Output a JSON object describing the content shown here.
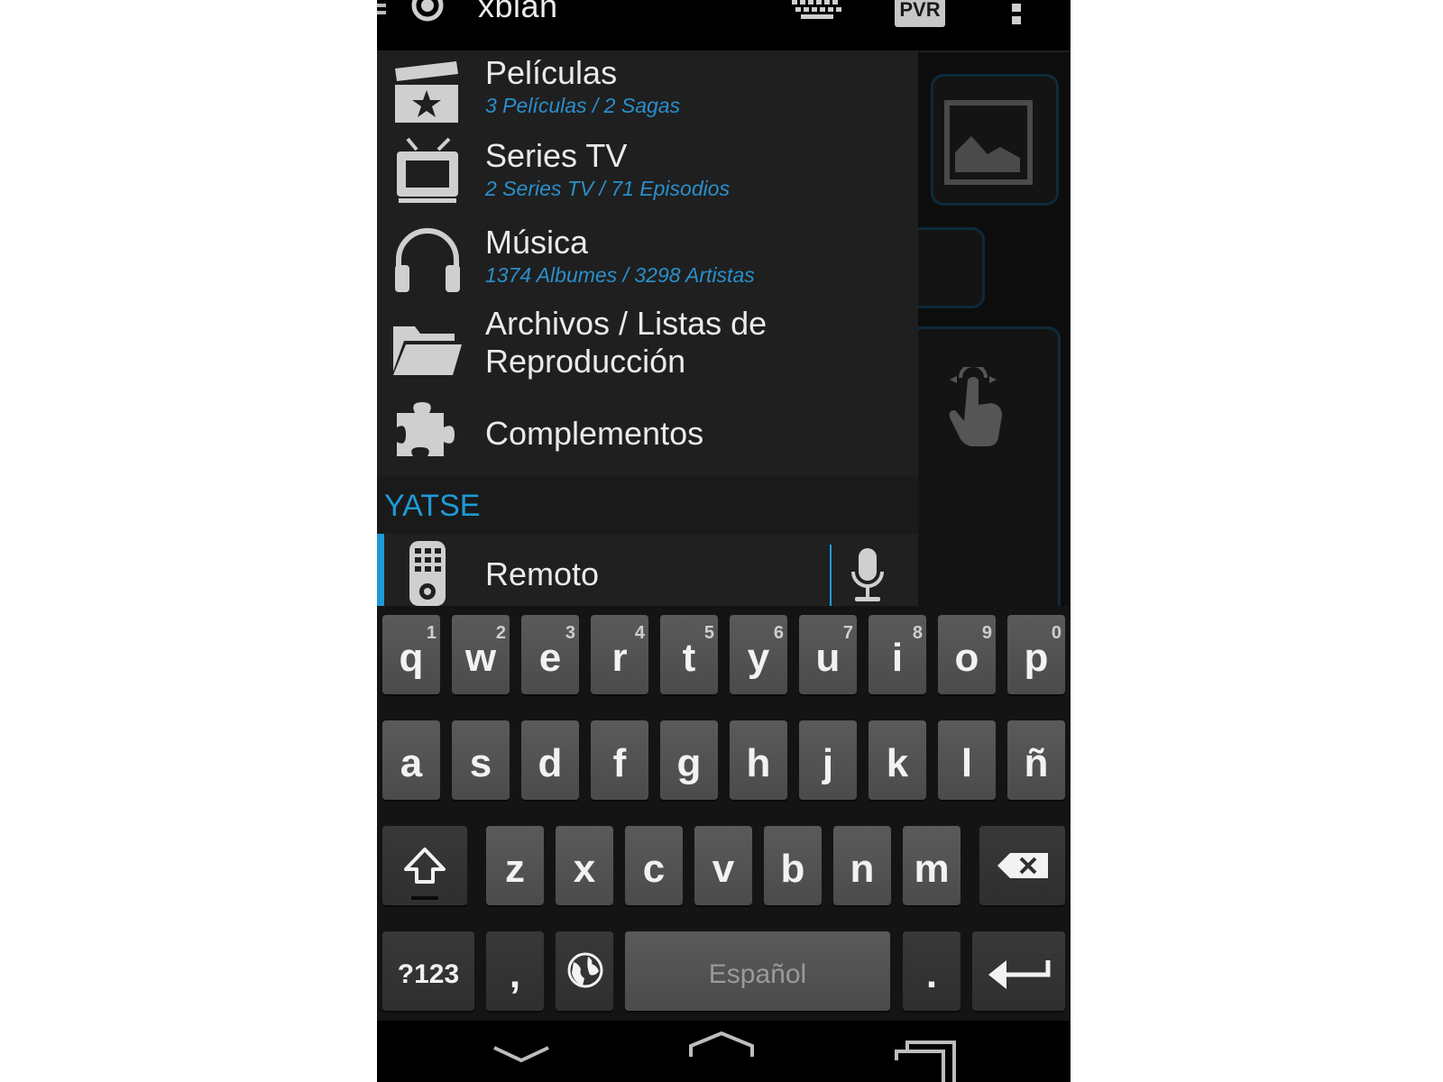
{
  "app": {
    "title": "xbian",
    "pvr_label": "PVR"
  },
  "icons": {
    "menu": "hamburger-icon",
    "logo": "xbmc-logo-icon",
    "keyboard": "keyboard-icon",
    "overflow": "overflow-menu-icon",
    "movies": "clapperboard-star-icon",
    "tv": "television-icon",
    "music": "headphones-icon",
    "files": "folder-icon",
    "addons": "puzzle-icon",
    "remote": "remote-control-icon",
    "voice": "microphone-icon",
    "gesture": "touch-gesture-icon",
    "image": "image-placeholder-icon",
    "shift": "shift-icon",
    "backspace": "backspace-icon",
    "globe": "globe-icon",
    "enter": "enter-icon",
    "back": "back-nav-icon",
    "home": "home-nav-icon",
    "recents": "recents-nav-icon"
  },
  "colors": {
    "accent": "#1e9ad6",
    "drawer_bg": "#1f1f1f",
    "key_bg": "#555555"
  },
  "drawer": {
    "items": [
      {
        "title": "Películas",
        "subtitle": "3 Películas / 2 Sagas"
      },
      {
        "title": "Series TV",
        "subtitle": "2 Series TV / 71 Episodios"
      },
      {
        "title": "Música",
        "subtitle": "1374 Albumes / 3298 Artistas"
      },
      {
        "title": "Archivos / Listas de Reproducción",
        "subtitle": ""
      },
      {
        "title": "Complementos",
        "subtitle": ""
      }
    ],
    "section": "YATSE",
    "remote_label": "Remoto"
  },
  "keyboard": {
    "row1": [
      {
        "k": "q",
        "h": "1"
      },
      {
        "k": "w",
        "h": "2"
      },
      {
        "k": "e",
        "h": "3"
      },
      {
        "k": "r",
        "h": "4"
      },
      {
        "k": "t",
        "h": "5"
      },
      {
        "k": "y",
        "h": "6"
      },
      {
        "k": "u",
        "h": "7"
      },
      {
        "k": "i",
        "h": "8"
      },
      {
        "k": "o",
        "h": "9"
      },
      {
        "k": "p",
        "h": "0"
      }
    ],
    "row2": [
      "a",
      "s",
      "d",
      "f",
      "g",
      "h",
      "j",
      "k",
      "l",
      "ñ"
    ],
    "row3": [
      "z",
      "x",
      "c",
      "v",
      "b",
      "n",
      "m"
    ],
    "symbols_label": "?123",
    "comma": ",",
    "period": ".",
    "space_label": "Español"
  }
}
